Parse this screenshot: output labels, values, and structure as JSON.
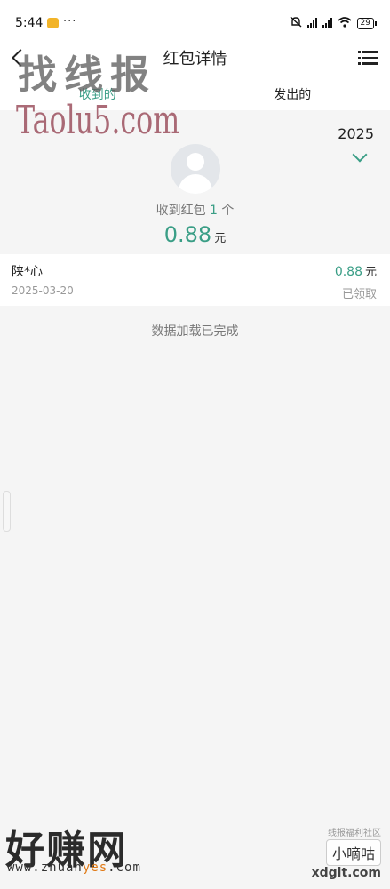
{
  "status_bar": {
    "time": "5:44",
    "more": "···",
    "battery": "29",
    "icons": [
      "notification-icon",
      "mute-icon",
      "hd-signal-icon",
      "hd-signal-icon",
      "wifi-icon",
      "battery-icon"
    ]
  },
  "header": {
    "title": "红包详情",
    "back_icon": "back-arrow-icon",
    "menu_icon": "list-menu-icon"
  },
  "tabs": [
    {
      "label": "收到的",
      "active": true
    },
    {
      "label": "发出的",
      "active": false
    }
  ],
  "summary": {
    "year": "2025",
    "count_prefix": "收到红包",
    "count": "1",
    "count_suffix": "个",
    "total": "0.88",
    "unit": "元"
  },
  "records": [
    {
      "name": "陕*心",
      "date": "2025-03-20",
      "amount": "0.88",
      "unit": "元",
      "status": "已领取"
    }
  ],
  "footer_text": "数据加载已完成",
  "watermarks": {
    "top": "找线报",
    "taolu": "Taolu5.com",
    "bottom": "好赚网",
    "site_prefix": "www.zhuan",
    "site_highlight": "yes",
    "site_suffix": ".com",
    "small": "线报福利社区",
    "badge": "小嘀咕",
    "xd": "xdglt.com"
  },
  "colors": {
    "accent": "#3a9e86",
    "background": "#f5f5f5"
  }
}
